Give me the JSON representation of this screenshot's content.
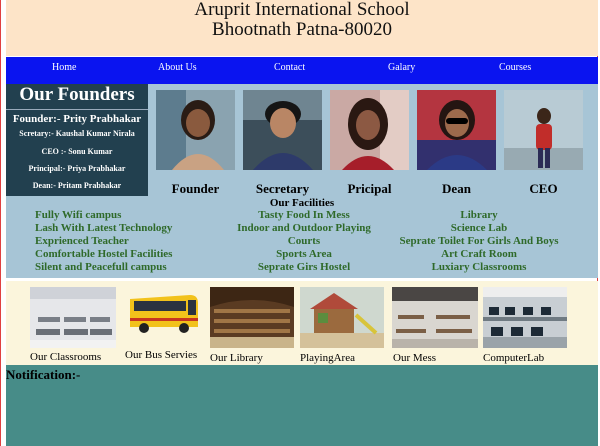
{
  "header": {
    "school_name": "Aruprit International School",
    "address": "Bhootnath Patna-80020"
  },
  "nav": [
    "Home",
    "About Us",
    "Contact",
    "Galary",
    "Courses"
  ],
  "founders": {
    "title": "Our Founders",
    "founder": "Founder:- Prity Prabhakar",
    "secretary": "Scretary:- Kaushal Kumar Nirala",
    "ceo": "CEO :- Sonu Kumar",
    "principal": "Principal:- Priya Prabhakar",
    "dean": "Dean:- Pritam Prabhakar",
    "roles": [
      "Founder",
      "Secretary",
      "Pricipal",
      "Dean",
      "CEO"
    ]
  },
  "facilities": {
    "title": "Our Facilities",
    "col1": [
      "Fully Wifi campus",
      "Lash With Latest Technology",
      "Exprienced Teacher",
      "Comfortable Hostel Facilities",
      "Silent and Peacefull campus"
    ],
    "col2": [
      "Tasty Food In Mess",
      "Indoor and Outdoor Playing",
      "Courts",
      "Sports Area",
      "Seprate Girs Hostel"
    ],
    "col3": [
      "Library",
      "Science Lab",
      "Seprate Toilet For Girls And Boys",
      "Art Craft Room",
      "Luxiary Classrooms"
    ]
  },
  "gallery": [
    "Our Classrooms",
    "Our Bus Servies",
    "Our Library",
    "PlayingArea",
    "Our Mess",
    "ComputerLab"
  ],
  "notification": {
    "label": "Notification:-"
  }
}
